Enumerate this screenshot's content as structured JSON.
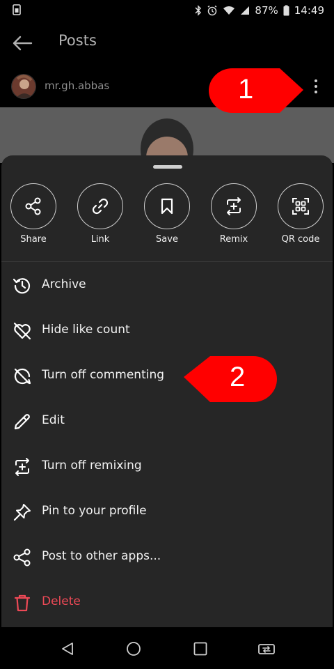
{
  "status_bar": {
    "battery_percent": "87%",
    "time": "14:49",
    "icons": [
      "sim-card-icon",
      "bluetooth-icon",
      "alarm-icon",
      "wifi-icon",
      "signal-icon",
      "battery-icon"
    ]
  },
  "header": {
    "title": "Posts",
    "back_icon": "arrow-left-icon"
  },
  "post": {
    "username": "mr.gh.abbas",
    "more_icon": "more-vertical-icon"
  },
  "annotations": {
    "callout_1": "1",
    "callout_2": "2",
    "color": "#ff0000"
  },
  "sheet": {
    "quick_actions": [
      {
        "label": "Share",
        "icon": "share-icon"
      },
      {
        "label": "Link",
        "icon": "link-icon"
      },
      {
        "label": "Save",
        "icon": "bookmark-icon"
      },
      {
        "label": "Remix",
        "icon": "remix-icon"
      },
      {
        "label": "QR code",
        "icon": "qr-code-icon"
      }
    ],
    "menu": [
      {
        "label": "Archive",
        "icon": "archive-icon"
      },
      {
        "label": "Hide like count",
        "icon": "heart-off-icon"
      },
      {
        "label": "Turn off commenting",
        "icon": "comment-off-icon"
      },
      {
        "label": "Edit",
        "icon": "pencil-icon"
      },
      {
        "label": "Turn off remixing",
        "icon": "remix-icon"
      },
      {
        "label": "Pin to your profile",
        "icon": "pin-icon"
      },
      {
        "label": "Post to other apps...",
        "icon": "share-icon"
      },
      {
        "label": "Delete",
        "icon": "trash-icon",
        "color": "#ed4956"
      }
    ]
  },
  "nav_bar": {
    "icons": [
      "back-triangle-icon",
      "home-circle-icon",
      "recents-square-icon",
      "switch-apps-icon"
    ]
  },
  "colors": {
    "sheet_background": "#262626",
    "danger": "#ed4956"
  }
}
